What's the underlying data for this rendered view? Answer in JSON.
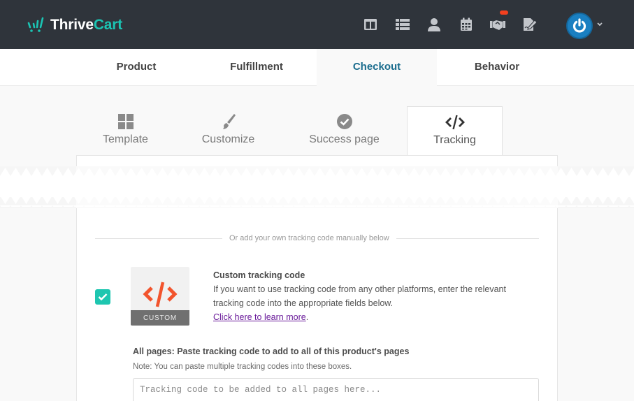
{
  "app": {
    "brand_part1": "Thrive",
    "brand_part2": "Cart",
    "brand_color": "#1bc5b4",
    "topbar_color": "#2f343b"
  },
  "nav_icons": [
    {
      "name": "layout-columns-icon"
    },
    {
      "name": "list-icon"
    },
    {
      "name": "user-icon"
    },
    {
      "name": "calendar-icon"
    },
    {
      "name": "handshake-icon",
      "has_notification": true
    },
    {
      "name": "edit-document-icon"
    }
  ],
  "main_tabs": [
    {
      "label": "Product",
      "active": false
    },
    {
      "label": "Fulfillment",
      "active": false
    },
    {
      "label": "Checkout",
      "active": true
    },
    {
      "label": "Behavior",
      "active": false
    }
  ],
  "sub_tabs": [
    {
      "label": "Template",
      "icon": "grid-icon",
      "active": false
    },
    {
      "label": "Customize",
      "icon": "brush-icon",
      "active": false
    },
    {
      "label": "Success page",
      "icon": "check-circle-icon",
      "active": false
    },
    {
      "label": "Tracking",
      "icon": "code-icon",
      "active": true
    }
  ],
  "tracking": {
    "divider_text": "Or add your own tracking code manually below",
    "custom": {
      "checked": true,
      "tile_label": "CUSTOM",
      "title": "Custom tracking code",
      "description": "If you want to use tracking code from any other platforms, enter the relevant tracking code into the appropriate fields below.",
      "link_text": "Click here to learn more",
      "link_suffix": "."
    },
    "all_pages": {
      "label": "All pages: Paste tracking code to add to all of this product's pages",
      "note": "Note: You can paste multiple tracking codes into these boxes.",
      "placeholder": "Tracking code to be added to all pages here...",
      "value": ""
    }
  },
  "colors": {
    "active_tab": "#1b6d8e",
    "checkbox": "#1ec6b0",
    "custom_code_icon": "#f2542d",
    "link": "#6a1b9a",
    "avatar": "#1a7fc1",
    "notification": "#f2401f"
  }
}
